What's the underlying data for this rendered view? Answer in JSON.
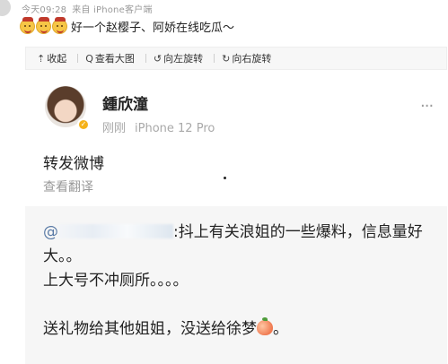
{
  "meta": {
    "time": "今天09:28",
    "source": "来自 iPhone客户端"
  },
  "comment": {
    "emoji_name": "angry-face-emoji",
    "emoji_count": 3,
    "text": "好一个赵樱子、阿娇在线吃瓜～"
  },
  "toolbar": {
    "items": [
      {
        "icon": "collapse-icon",
        "glyph": "⇡",
        "label": "收起"
      },
      {
        "icon": "zoom-icon",
        "glyph": "Q",
        "label": "查看大图"
      },
      {
        "icon": "rotate-left-icon",
        "glyph": "↺",
        "label": "向左旋转"
      },
      {
        "icon": "rotate-right-icon",
        "glyph": "↻",
        "label": "向右旋转"
      }
    ]
  },
  "post": {
    "username": "鍾欣潼",
    "time": "刚刚",
    "device": "iPhone 12 Pro",
    "more_glyph": "···",
    "verified_glyph": "✓",
    "repost_text": "转发微博",
    "translate_label": "查看翻译"
  },
  "quote": {
    "at_sign": "@",
    "line1_rest": ":抖上有关浪姐的一些爆料，信息量好大。。",
    "line2": "上大号不冲厕所。。。。",
    "line3": "送礼物给其他姐姐，没送给徐梦",
    "line3_end": "。"
  },
  "colors": {
    "link": "#5a7ba6",
    "muted": "#a9a9a9",
    "quote_bg": "#f6f6f6",
    "verified": "#f5b21a"
  }
}
